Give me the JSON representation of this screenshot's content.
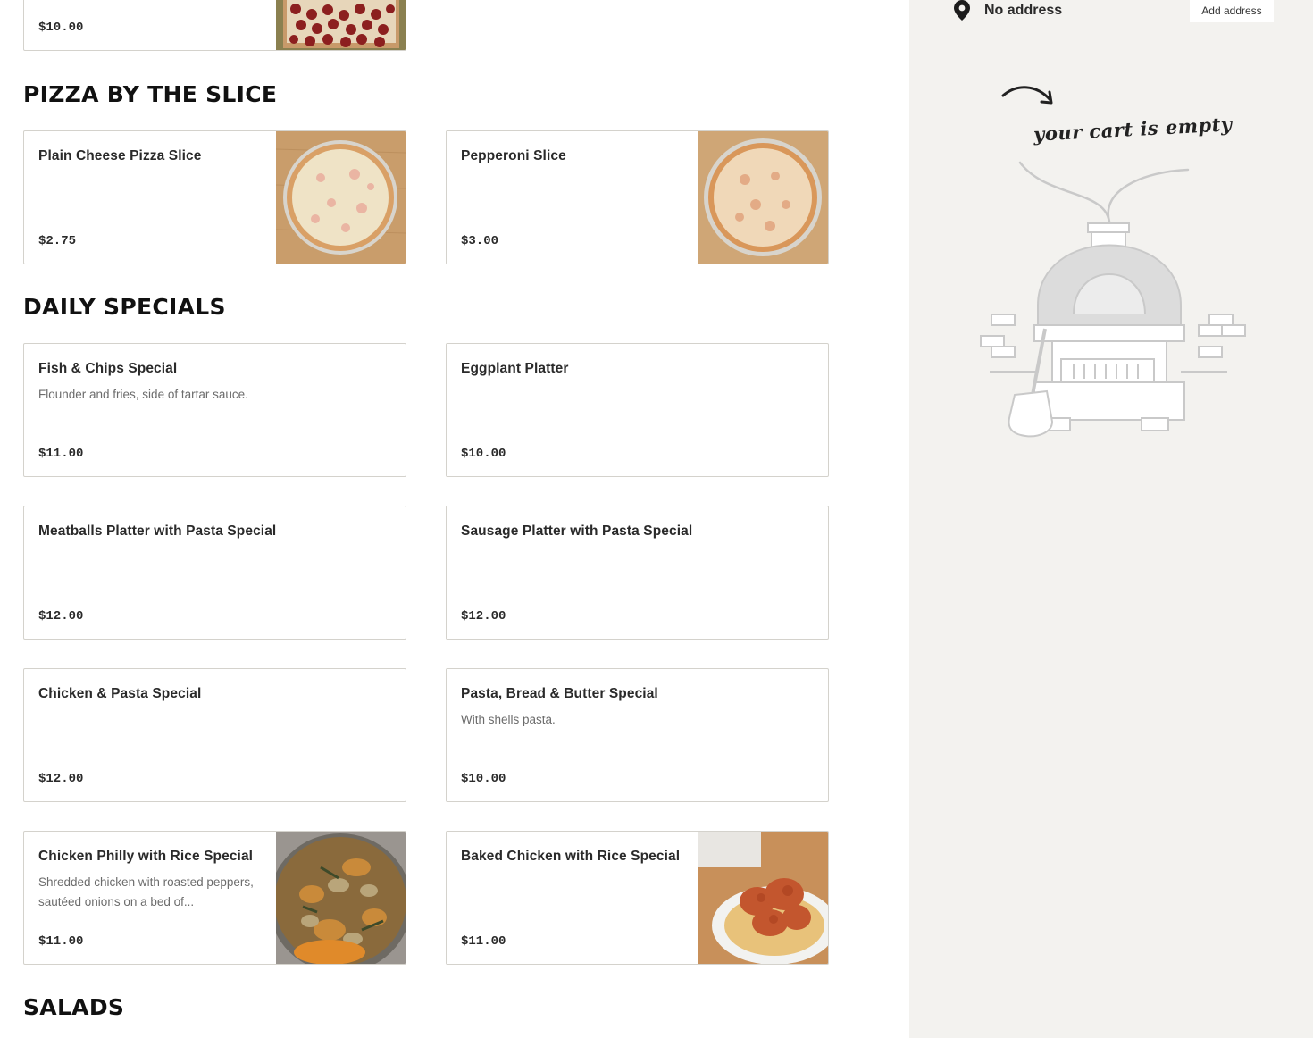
{
  "sections": {
    "pizza_by_the_slice": "PIZZA BY THE SLICE",
    "daily_specials": "DAILY SPECIALS",
    "salads": "SALADS"
  },
  "top_item": {
    "price": "$10.00"
  },
  "slices": [
    {
      "name": "Plain Cheese Pizza Slice",
      "price": "$2.75"
    },
    {
      "name": "Pepperoni Slice",
      "price": "$3.00"
    }
  ],
  "specials": [
    {
      "name": "Fish & Chips Special",
      "description": "Flounder and fries, side of tartar sauce.",
      "price": "$11.00"
    },
    {
      "name": "Eggplant Platter",
      "description": "",
      "price": "$10.00"
    },
    {
      "name": "Meatballs Platter with Pasta Special",
      "description": "",
      "price": "$12.00"
    },
    {
      "name": "Sausage Platter with Pasta Special",
      "description": "",
      "price": "$12.00"
    },
    {
      "name": "Chicken & Pasta Special",
      "description": "",
      "price": "$12.00"
    },
    {
      "name": "Pasta, Bread & Butter Special",
      "description": "With shells pasta.",
      "price": "$10.00"
    },
    {
      "name": "Chicken Philly with Rice Special",
      "description": "Shredded chicken with roasted peppers, sautéed onions on a bed of...",
      "price": "$11.00"
    },
    {
      "name": "Baked Chicken with Rice Special",
      "description": "",
      "price": "$11.00"
    }
  ],
  "sidebar": {
    "address_text": "No address",
    "add_address_label": "Add address",
    "cart_empty": "your cart is empty"
  },
  "colors": {
    "sidebar_bg": "#f3f2ef",
    "card_border": "#d4d2cc",
    "illustration": "#c9c9c9"
  },
  "icons": [
    "map-pin-icon",
    "arrow-icon"
  ]
}
